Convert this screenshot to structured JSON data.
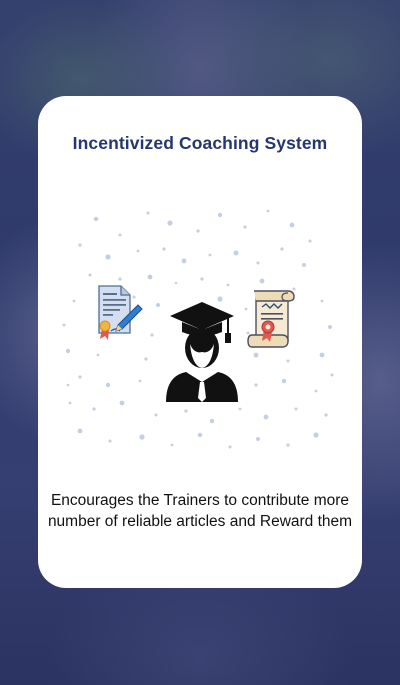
{
  "card": {
    "title": "Incentivized Coaching System",
    "description": "Encourages the Trainers to contribute more number of reliable articles and Reward them"
  },
  "illustration": {
    "icons": [
      "document-pen-icon",
      "graduate-icon",
      "certificate-scroll-icon"
    ],
    "colors": {
      "dots": "#c3cfe2",
      "graduate": "#111111",
      "doc": "#c9d8ec",
      "pen": "#2d7fd3",
      "ribbon": "#e0584f",
      "badge": "#f2b540"
    }
  },
  "colors": {
    "background": "#2f3a6c",
    "card": "#ffffff",
    "title": "#253770",
    "text": "#111111"
  }
}
